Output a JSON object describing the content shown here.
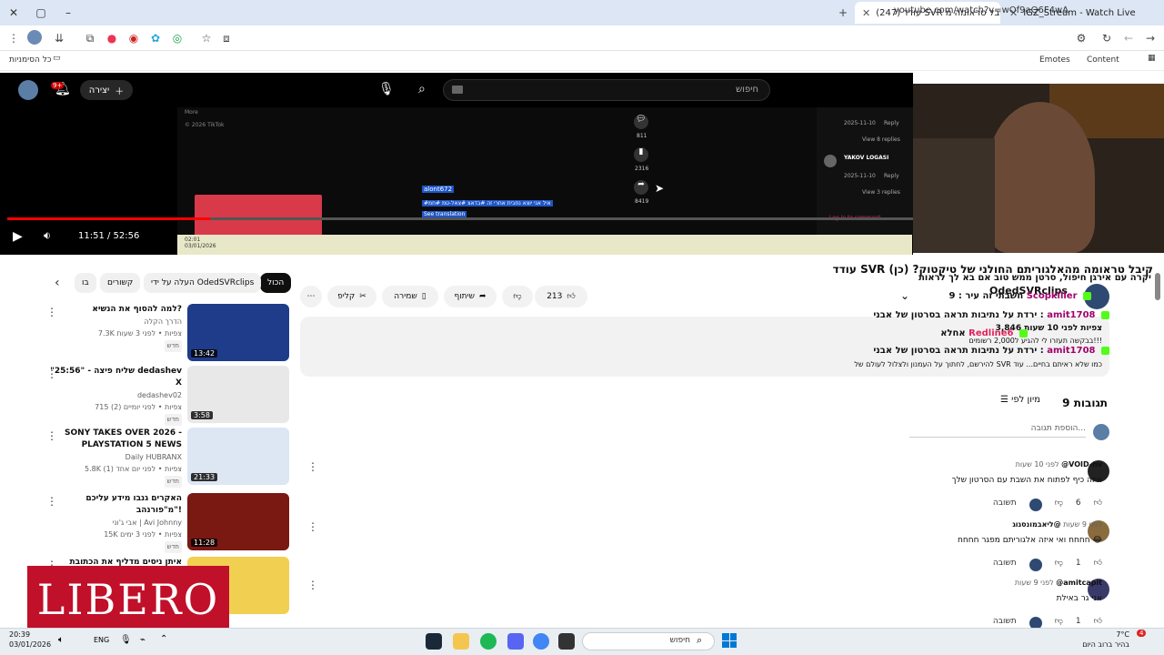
{
  "browser": {
    "tabs": [
      {
        "title": "IGZ_Stream - Watch Live on Kick",
        "active": false
      },
      {
        "title": "(247) עודד SVR קיבל טראומה מ",
        "active": true
      }
    ],
    "url": "youtube.com/watch?v=wOf9aQ6F4wA",
    "bookmarks_left": "כל הסימניות",
    "bookmarks_right": [
      "Emotes",
      "Content"
    ]
  },
  "yt_header": {
    "create_label": "יצירה",
    "notif_count": "9+",
    "search_placeholder": "חיפוש"
  },
  "player": {
    "time": "11:51 / 52:56",
    "progress_fraction": 0.224,
    "tiktok_user": "alont672",
    "tiktok_caption": "#איל אני יוצא נחבית אחרי זה #בדאצ #צאל-טמ #חמ",
    "see_translation": "See translation",
    "footer_more": "More",
    "footer_copy": "© 2026 TikTok",
    "comment_counts": [
      "811",
      "2316",
      "8419"
    ],
    "side_names": [
      "YAKOV LOGASI"
    ],
    "side_dates": [
      "2025-11-10",
      "2025-11-10"
    ],
    "side_reply": "Reply",
    "view_replies": [
      "View 8 replies",
      "View 3 replies"
    ],
    "login_comment": "Log in to comment",
    "mini_date": "03/01/2026",
    "mini_time": "02:01"
  },
  "chips": [
    "הכול",
    "העלה על ידי OdedSVRclips",
    "קשורים",
    "בו"
  ],
  "recommendations": [
    {
      "title": "למה להסוף את הנשיא?",
      "channel": "הדרך הקלה",
      "views": "7.3K צפיות • לפני 3 שעות",
      "badge": "חדש",
      "duration": "13:42",
      "color": "#1e3c8a"
    },
    {
      "title": "\"25:56\" - שליח פיצה dedashev X",
      "channel": "dedashev02",
      "views": "715 צפיות • לפני יומיים (2)",
      "badge": "חדש",
      "duration": "3:58",
      "color": "#e8e8e8"
    },
    {
      "title": "SONY TAKES OVER 2026 - PLAYSTATION 5 NEWS",
      "channel": "Daily HUBRANX",
      "views": "5.8K צפיות • לפני יום אחד (1)",
      "badge": "חדש",
      "duration": "21:33",
      "color": "#dde6f3"
    },
    {
      "title": "האקרים גנבו מידע עליכם מ\"פורנהב\"!",
      "channel": "אבי ג'וני | Avi Johnny",
      "views": "15K צפיות • לפני 3 ימים",
      "badge": "חדש",
      "duration": "11:28",
      "color": "#7a1812"
    },
    {
      "title": "איתן ניסים מדליף את הכתובת",
      "channel": "",
      "views": "",
      "badge": "",
      "duration": "",
      "color": "#f1cf50"
    }
  ],
  "video": {
    "title": "עודד SVR קיבל טראומה מהאלגוריתם החולני של טיקטוק? (כן)",
    "likes": "213",
    "share": "שיתוף",
    "save": "שמירה",
    "clip": "קליפ",
    "channel": "OdedSVRclips",
    "views_line": "3,846 צפיות  לפני 10 שעות",
    "subscribe": "הרשמה",
    "desc_line1": "בבקשה תעזרו לי להגיע ל2,000 רשומים!!!",
    "desc_tail": "להירשם, לחתוך על העמנון ולצלול לעולם של SVR כמו שלא ראיתם בחיים... עוד"
  },
  "chat": [
    {
      "user": "",
      "text": "יקרה עם אירגן חיפול, סרטן ממש טוב אם בא לך לראות"
    },
    {
      "user": "Scopkiller",
      "text": "חשבתי זה עיר : 9"
    },
    {
      "user": "amit1708",
      "text": "ירדת על נתיבות תראה בסרטון של אבני :"
    },
    {
      "user": "Redline6",
      "text": "אחלא"
    },
    {
      "user": "amit1708",
      "text": "ירדת על נתיבות תראה בסרטון של אבני :"
    }
  ],
  "comments": {
    "count_label": "9 תגובות",
    "sort_label": "מיון לפי",
    "add_placeholder": "הוספת תגובה...",
    "reply_label": "תשובה",
    "items": [
      {
        "author": "@VOID-nv",
        "time": "לפני 10 שעות",
        "text": "איזה כיף לפתוח את השבת עם הסרטון שלך",
        "likes": "6"
      },
      {
        "author": "@ליאבמונסגוג",
        "time": "לפני 9 שעות",
        "text": "חחחח ואי איזה אלגוריתם מפגר חחחח 😂",
        "likes": "1"
      },
      {
        "author": "@amitcapit",
        "time": "לפני 9 שעות",
        "text": "אני גר באילת",
        "likes": "1"
      }
    ]
  },
  "overlay_logo": "LIBERO",
  "taskbar": {
    "clock_time": "20:39",
    "clock_date": "03/01/2026",
    "lang": "ENG",
    "search_placeholder": "חיפוש",
    "weather_temp": "7°C",
    "weather_desc": "בהיר ברוב היום",
    "notif_count": "4"
  }
}
